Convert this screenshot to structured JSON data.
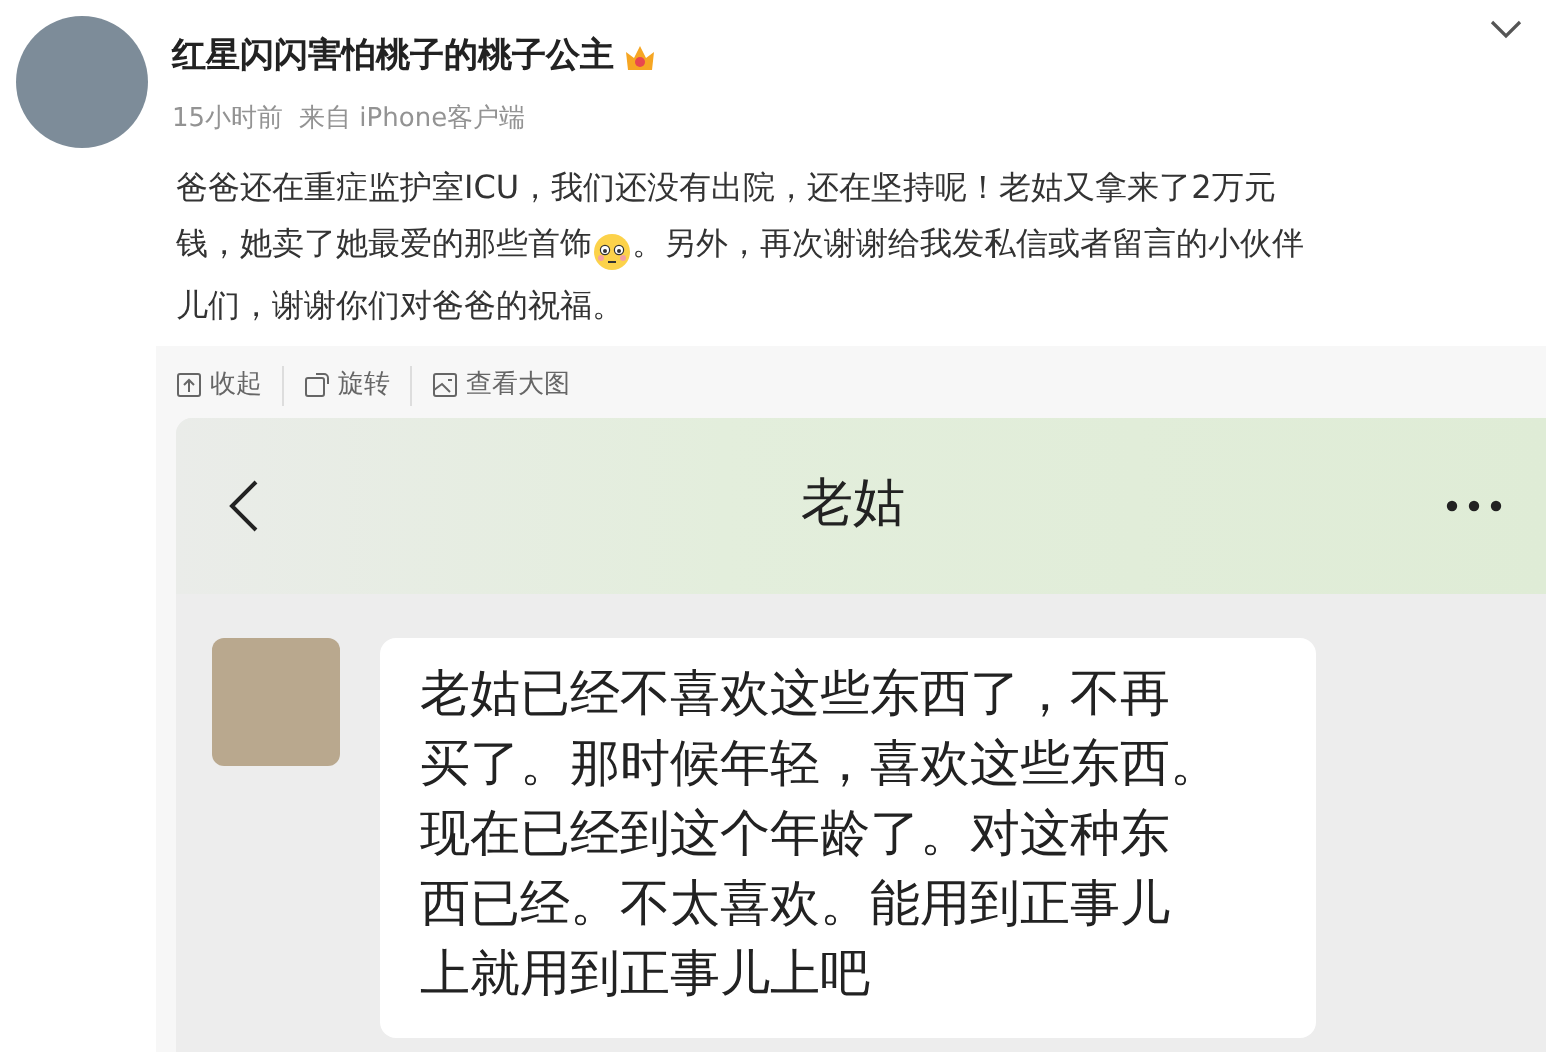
{
  "post": {
    "author": "红星闪闪害怕桃子的桃子公主",
    "time": "15小时前",
    "source": "来自 iPhone客户端",
    "body_lines": [
      [
        "爸爸还在重症监护室ICU，我们还没有出院，还在坚持呢！老姑又拿来了2万元"
      ],
      [
        "钱，她卖了她最爱的那些首饰",
        "。另外，再次谢谢给我发私信或者留言的小伙伴"
      ],
      [
        "儿们，谢谢你们对爸爸的祝福。"
      ]
    ]
  },
  "image_toolbar": [
    {
      "kind": "collapse",
      "label": "收起"
    },
    {
      "kind": "rotate",
      "label": "旋转"
    },
    {
      "kind": "view",
      "label": "查看大图"
    }
  ],
  "chat": {
    "title": "老姑",
    "message_lines": [
      "老姑已经不喜欢这些东西了，不再",
      "买了。那时候年轻，喜欢这些东西。",
      "现在已经到这个年龄了。对这种东",
      "西已经。不太喜欢。能用到正事儿",
      "上就用到正事儿上吧"
    ]
  }
}
